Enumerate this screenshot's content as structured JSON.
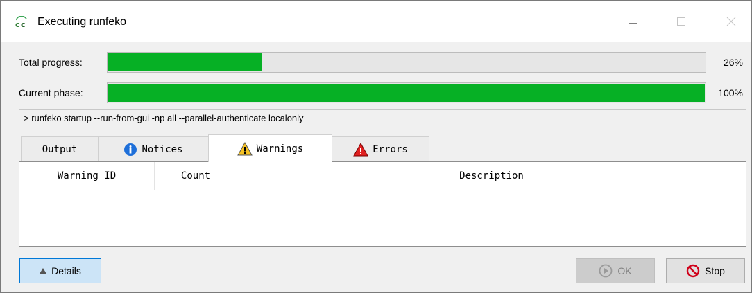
{
  "window": {
    "title": "Executing runfeko",
    "icon": "feko-app-icon"
  },
  "window_controls": {
    "minimize": "minimize-icon",
    "maximize": "maximize-icon",
    "close": "close-icon"
  },
  "progress": {
    "total": {
      "label": "Total progress:",
      "percent_text": "26%",
      "value": 0.26
    },
    "phase": {
      "label": "Current phase:",
      "percent_text": "100%",
      "value": 1.0
    }
  },
  "command_line": "> runfeko startup --run-from-gui -np all --parallel-authenticate localonly",
  "tabs": [
    {
      "label": "Output",
      "icon": null,
      "active": false
    },
    {
      "label": "Notices",
      "icon": "info-icon",
      "active": false
    },
    {
      "label": "Warnings",
      "icon": "warning-icon",
      "active": true
    },
    {
      "label": "Errors",
      "icon": "error-icon",
      "active": false
    }
  ],
  "warnings_table": {
    "columns": [
      "Warning ID",
      "Count",
      "Description"
    ],
    "rows": []
  },
  "buttons": {
    "details": "Details",
    "ok": "OK",
    "stop": "Stop"
  },
  "colors": {
    "progress_fill": "#06b025",
    "focus_border": "#0078d7",
    "stop_red": "#d0021b"
  }
}
